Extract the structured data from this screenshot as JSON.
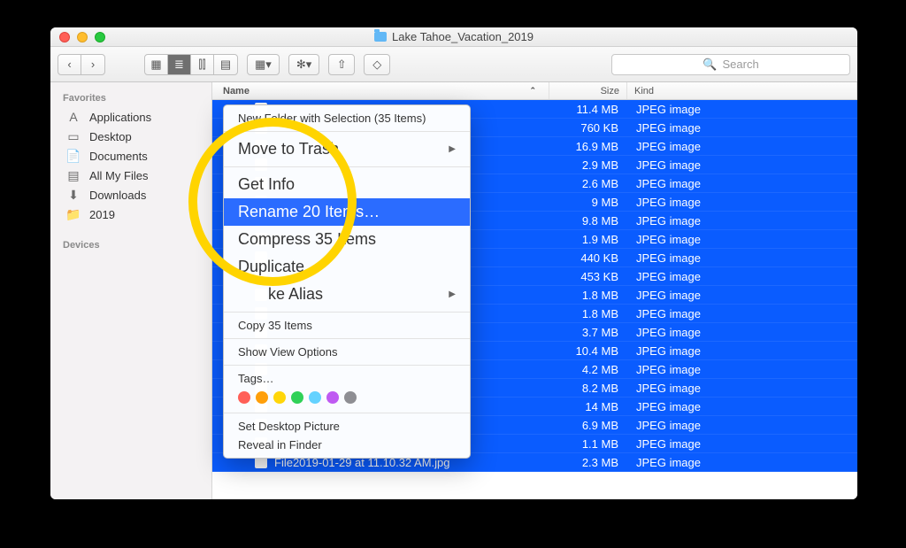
{
  "window": {
    "title": "Lake Tahoe_Vacation_2019"
  },
  "toolbar": {
    "search_placeholder": "Search"
  },
  "sidebar": {
    "favorites_header": "Favorites",
    "devices_header": "Devices",
    "items": [
      {
        "icon": "A",
        "label": "Applications"
      },
      {
        "icon": "▭",
        "label": "Desktop"
      },
      {
        "icon": "📄",
        "label": "Documents"
      },
      {
        "icon": "▤",
        "label": "All My Files"
      },
      {
        "icon": "⬇",
        "label": "Downloads"
      },
      {
        "icon": "📁",
        "label": "2019"
      }
    ]
  },
  "columns": {
    "name": "Name",
    "size": "Size",
    "kind": "Kind"
  },
  "rows": [
    {
      "name": "",
      "size": "11.4 MB",
      "kind": "JPEG image"
    },
    {
      "name": "",
      "size": "760 KB",
      "kind": "JPEG image"
    },
    {
      "name": "",
      "size": "16.9 MB",
      "kind": "JPEG image"
    },
    {
      "name": "",
      "size": "2.9 MB",
      "kind": "JPEG image"
    },
    {
      "name": "",
      "size": "2.6 MB",
      "kind": "JPEG image"
    },
    {
      "name": "",
      "size": "9 MB",
      "kind": "JPEG image"
    },
    {
      "name": "",
      "size": "9.8 MB",
      "kind": "JPEG image"
    },
    {
      "name": "",
      "size": "1.9 MB",
      "kind": "JPEG image"
    },
    {
      "name": "",
      "size": "440 KB",
      "kind": "JPEG image"
    },
    {
      "name": "",
      "size": "453 KB",
      "kind": "JPEG image"
    },
    {
      "name": "",
      "size": "1.8 MB",
      "kind": "JPEG image"
    },
    {
      "name": "",
      "size": "1.8 MB",
      "kind": "JPEG image"
    },
    {
      "name": "",
      "size": "3.7 MB",
      "kind": "JPEG image"
    },
    {
      "name": "",
      "size": "10.4 MB",
      "kind": "JPEG image"
    },
    {
      "name": "",
      "size": "4.2 MB",
      "kind": "JPEG image"
    },
    {
      "name": "",
      "size": "8.2 MB",
      "kind": "JPEG image"
    },
    {
      "name": "",
      "size": "14 MB",
      "kind": "JPEG image"
    },
    {
      "name": "",
      "size": "6.9 MB",
      "kind": "JPEG image"
    },
    {
      "name": "",
      "size": "1.1 MB",
      "kind": "JPEG image"
    },
    {
      "name": "File2019-01-29 at 11.10.32 AM.jpg",
      "size": "2.3 MB",
      "kind": "JPEG image"
    }
  ],
  "context_menu": {
    "new_folder": "New Folder with Selection (35 Items)",
    "move_trash": "Move to Trash",
    "get_info": "Get Info",
    "rename": "Rename 20 Items…",
    "compress": "Compress 35 Items",
    "duplicate": "Duplicate",
    "make_alias": "ke Alias",
    "copy": "Copy 35 Items",
    "show_view": "Show View Options",
    "tags": "Tags…",
    "set_desktop": "Set Desktop Picture",
    "reveal": "Reveal in Finder"
  },
  "tag_colors": [
    "#ff5f57",
    "#ff9f0a",
    "#ffd60a",
    "#30d158",
    "#64d2ff",
    "#bf5af2",
    "#8e8e93"
  ]
}
